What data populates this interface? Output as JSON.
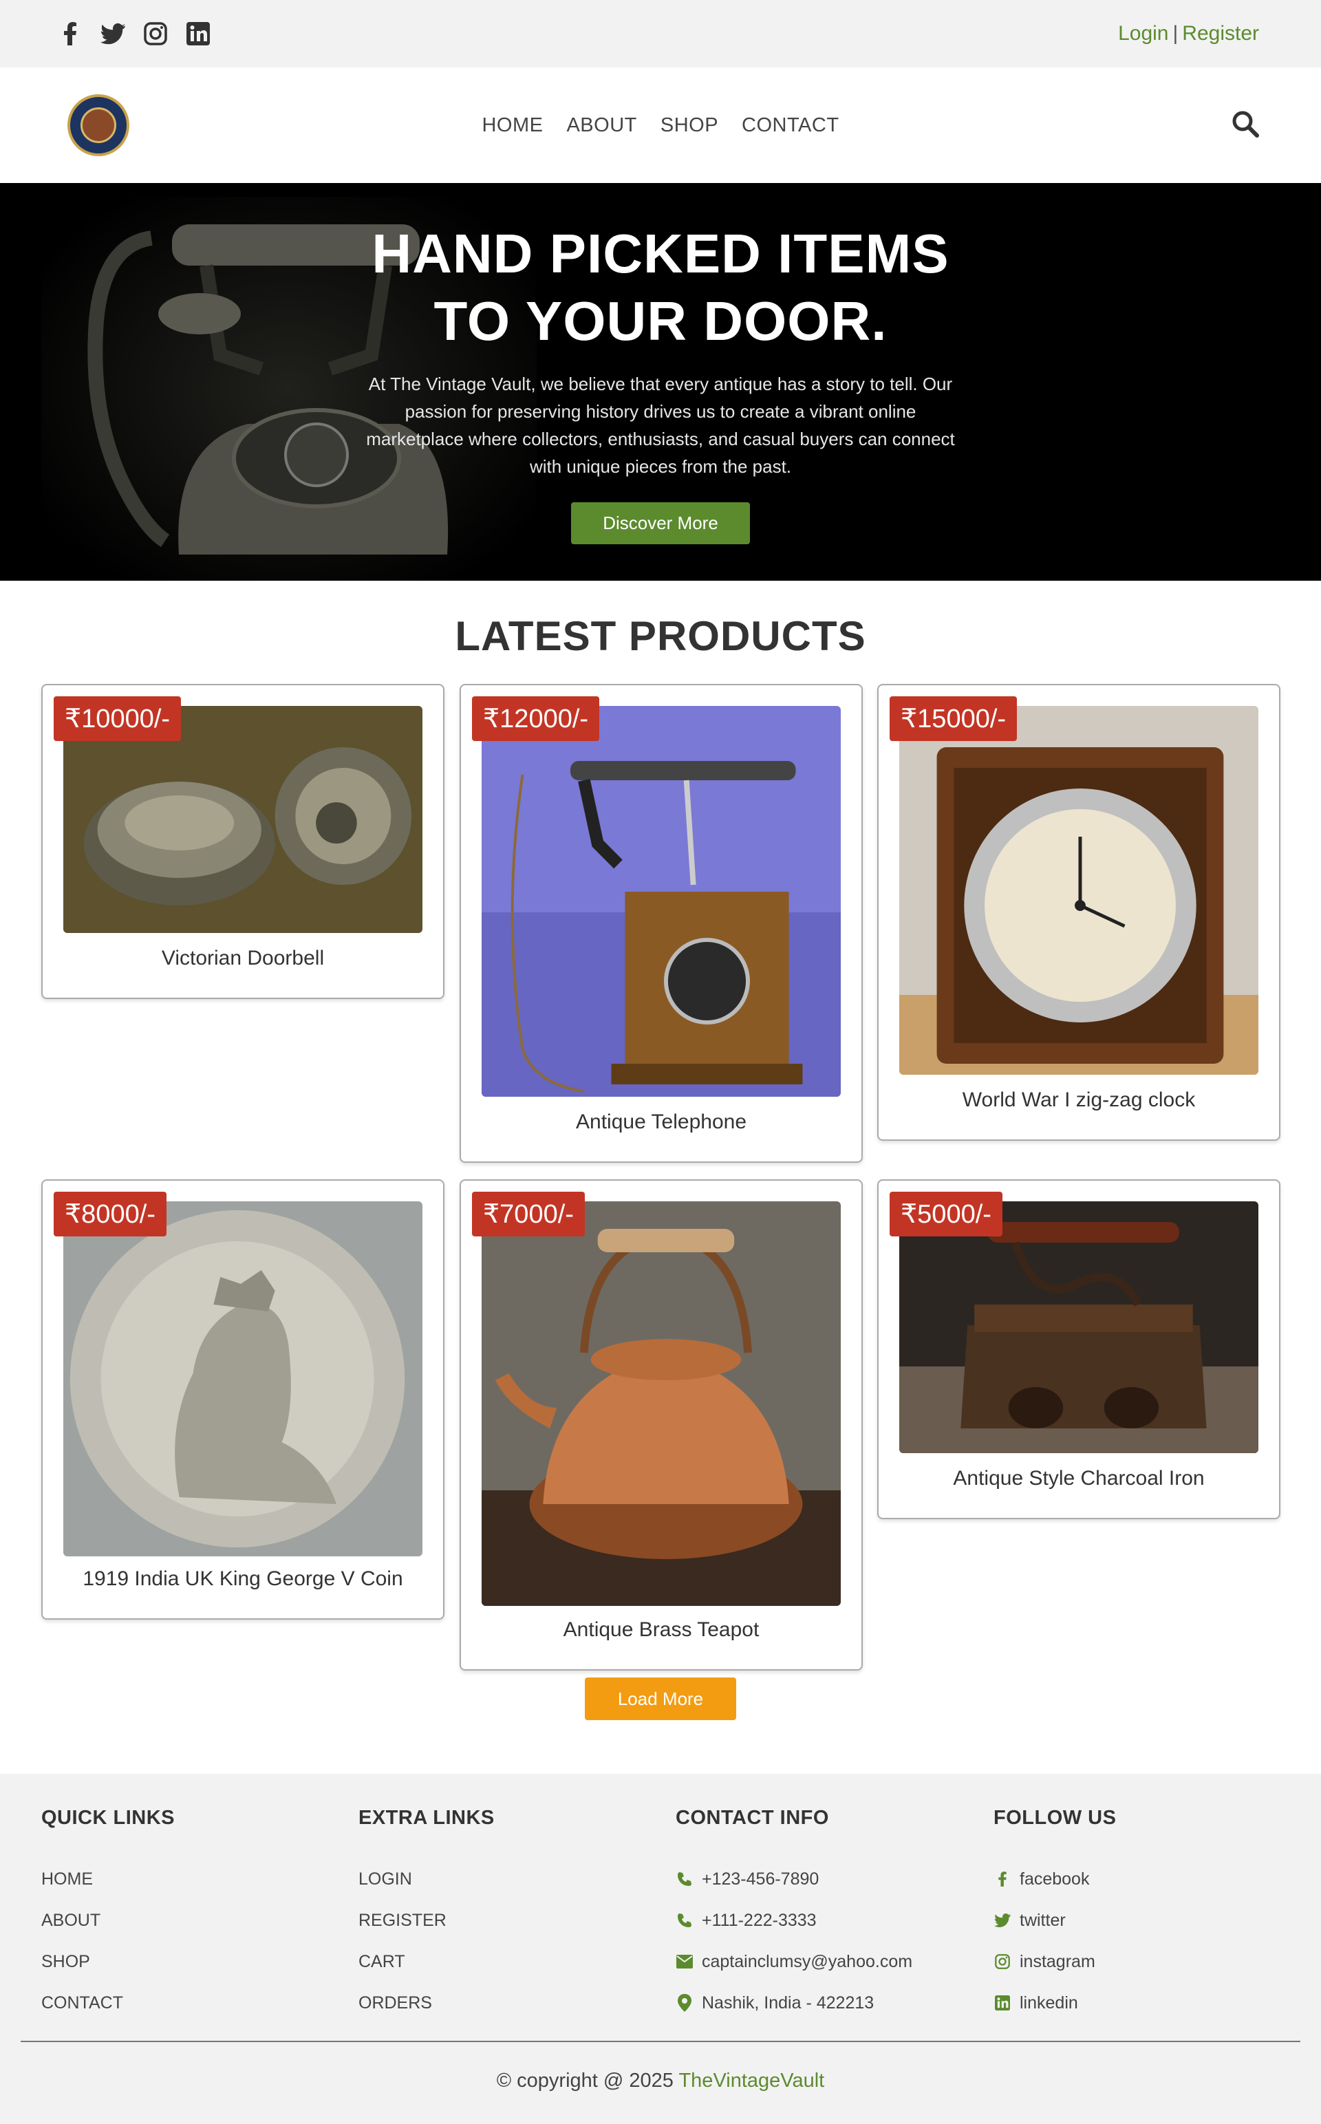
{
  "topbar": {
    "social_icons": [
      "facebook-icon",
      "twitter-icon",
      "instagram-icon",
      "linkedin-icon"
    ],
    "login": "Login",
    "separator": "|",
    "register": "Register"
  },
  "header": {
    "nav": [
      "HOME",
      "ABOUT",
      "SHOP",
      "CONTACT"
    ],
    "search_icon": "search-icon"
  },
  "hero": {
    "title_line1": "HAND PICKED ITEMS",
    "title_line2": "TO YOUR DOOR.",
    "text": "At The Vintage Vault, we believe that every antique has a story to tell. Our passion for preserving history drives us to create a vibrant online marketplace where collectors, enthusiasts, and casual buyers can connect with unique pieces from the past.",
    "button": "Discover More"
  },
  "products": {
    "title": "LATEST PRODUCTS",
    "items": [
      {
        "price": "₹10000/-",
        "name": "Victorian Doorbell"
      },
      {
        "price": "₹12000/-",
        "name": "Antique Telephone"
      },
      {
        "price": "₹15000/-",
        "name": "World War I zig-zag clock"
      },
      {
        "price": "₹8000/-",
        "name": "1919 India UK King George V Coin"
      },
      {
        "price": "₹7000/-",
        "name": "Antique Brass Teapot"
      },
      {
        "price": "₹5000/-",
        "name": "Antique Style Charcoal Iron"
      }
    ],
    "load_more": "Load More"
  },
  "footer": {
    "quick_links": {
      "title": "QUICK LINKS",
      "items": [
        "HOME",
        "ABOUT",
        "SHOP",
        "CONTACT"
      ]
    },
    "extra_links": {
      "title": "EXTRA LINKS",
      "items": [
        "LOGIN",
        "REGISTER",
        "CART",
        "ORDERS"
      ]
    },
    "contact_info": {
      "title": "CONTACT INFO",
      "items": [
        "+123-456-7890",
        "+111-222-3333",
        "captainclumsy@yahoo.com",
        "Nashik, India - 422213"
      ]
    },
    "follow_us": {
      "title": "FOLLOW US",
      "items": [
        "facebook",
        "twitter",
        "instagram",
        "linkedin"
      ]
    },
    "copyright_prefix": "© copyright @ 2025",
    "copyright_brand": "TheVintageVault"
  },
  "colors": {
    "accent": "#5c8b2e",
    "price_badge": "#c23525",
    "load_more": "#f39c12"
  }
}
